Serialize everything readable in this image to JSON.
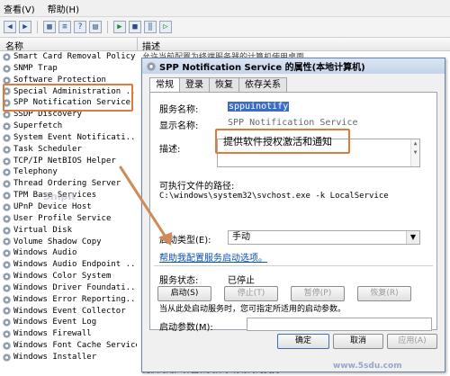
{
  "menubar": {
    "items": [
      "查看(V)",
      "帮助(H)"
    ]
  },
  "colheader": {
    "name": "名称",
    "desc": "描述"
  },
  "desc_strip": "允许当前配置为终端服务器的计算机使用桌面",
  "services": [
    "Smart Card Removal Policy",
    "SNMP Trap",
    "Software Protection",
    "Special Administration ...",
    "SPP Notification Service",
    "SSDP Discovery",
    "Superfetch",
    "System Event Notificati...",
    "Task Scheduler",
    "TCP/IP NetBIOS Helper",
    "Telephony",
    "Thread Ordering Server",
    "TPM Base Services",
    "UPnP Device Host",
    "User Profile Service",
    "Virtual Disk",
    "Volume Shadow Copy",
    "Windows Audio",
    "Windows Audio Endpoint ...",
    "Windows Color System",
    "Windows Driver Foundati...",
    "Windows Error Reporting...",
    "Windows Event Collector",
    "Windows Event Log",
    "Windows Firewall",
    "Windows Font Cache Service",
    "Windows Installer"
  ],
  "bottom_strip": "提供对用户界面和文件系统访问的支持",
  "dialog": {
    "title": "SPP Notification Service 的属性(本地计算机)",
    "tabs": [
      "常规",
      "登录",
      "恢复",
      "依存关系"
    ],
    "service_name_label": "服务名称:",
    "service_name": "sppuinotify",
    "display_name_label": "显示名称:",
    "display_name": "SPP Notification Service",
    "description_label": "描述:",
    "description": "提供软件授权激活和通知",
    "path_label": "可执行文件的路径:",
    "path": "C:\\windows\\system32\\svchost.exe -k LocalService",
    "startup_label": "启动类型(E):",
    "startup_value": "手动",
    "help_link": "帮助我配置服务启动选项。",
    "status_label": "服务状态:",
    "status_value": "已停止",
    "buttons": {
      "start": "启动(S)",
      "stop": "停止(T)",
      "pause": "暂停(P)",
      "resume": "恢复(R)"
    },
    "hint": "当从此处启动服务时，您可指定所适用的启动参数。",
    "params_label": "启动参数(M):",
    "ok": "确定",
    "cancel": "取消",
    "apply": "应用(A)"
  },
  "watermark": {
    "top": "Snipit",
    "bottom": "www.5sdu.com"
  },
  "colors": {
    "highlight": "#e07a3c",
    "link": "#0a4fb4",
    "title_bg": "#c3d4ea"
  }
}
